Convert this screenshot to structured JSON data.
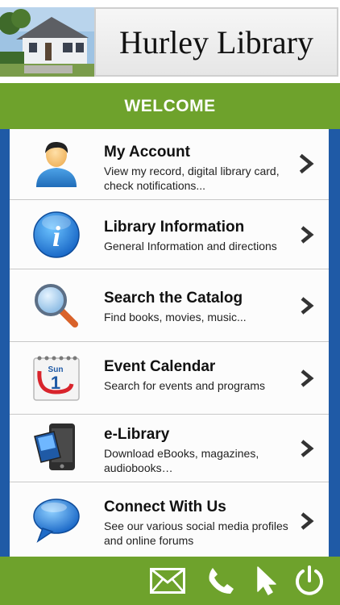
{
  "header": {
    "library_name": "Hurley Library"
  },
  "welcome": {
    "label": "WELCOME"
  },
  "menu": [
    {
      "title": "My Account",
      "subtitle": "View my record, digital library card, check notifications...",
      "icon": "user-icon"
    },
    {
      "title": "Library Information",
      "subtitle": "General Information and directions",
      "icon": "info-icon"
    },
    {
      "title": "Search the Catalog",
      "subtitle": "Find books, movies, music...",
      "icon": "magnifier-icon"
    },
    {
      "title": "Event Calendar",
      "subtitle": "Search for events and programs",
      "icon": "calendar-icon",
      "calendar_day": "Sun",
      "calendar_date": "1"
    },
    {
      "title": "e-Library",
      "subtitle": "Download eBooks, magazines, audiobooks…",
      "icon": "ebook-reader-icon"
    },
    {
      "title": "Connect With Us",
      "subtitle": "See our various social media profiles and online forums",
      "icon": "speech-bubble-icon"
    }
  ],
  "footer": {
    "buttons": [
      "email-icon",
      "phone-icon",
      "pointer-icon",
      "power-icon"
    ]
  },
  "colors": {
    "green": "#6ea22c",
    "blue_frame": "#1f5aa6"
  }
}
